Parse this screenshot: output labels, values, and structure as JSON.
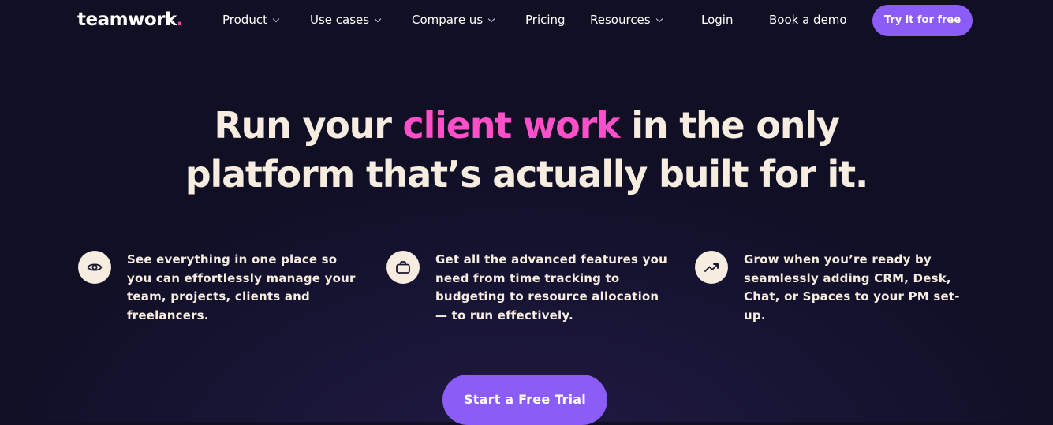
{
  "nav": {
    "logo_text": "teamwork",
    "logo_dot": ".",
    "items": [
      {
        "label": "Product"
      },
      {
        "label": "Use cases"
      },
      {
        "label": "Compare us"
      },
      {
        "label": "Pricing"
      },
      {
        "label": "Resources"
      }
    ],
    "login_label": "Login",
    "demo_label": "Book a demo",
    "try_label": "Try it for free"
  },
  "hero": {
    "headline_part1": "Run your ",
    "headline_accent": "client work",
    "headline_part2": " in the only",
    "headline_line2": "platform that’s actually built for it."
  },
  "features": [
    {
      "icon": "eye-icon",
      "text": "See everything in one place so you can effortlessly manage your team, projects, clients and freelancers."
    },
    {
      "icon": "briefcase-icon",
      "text": "Get all the advanced features you need from time tracking to budgeting to resource allocation — to run effectively."
    },
    {
      "icon": "trending-up-icon",
      "text": "Grow when you’re ready by seamlessly adding CRM, Desk, Chat, or Spaces to your PM set-up."
    }
  ],
  "cta": {
    "label": "Start a Free Trial"
  },
  "colors": {
    "background": "#100f24",
    "accent_purple": "#8b5cf6",
    "accent_pink": "#ff4fc9",
    "text_cream": "#f6ecdf"
  }
}
